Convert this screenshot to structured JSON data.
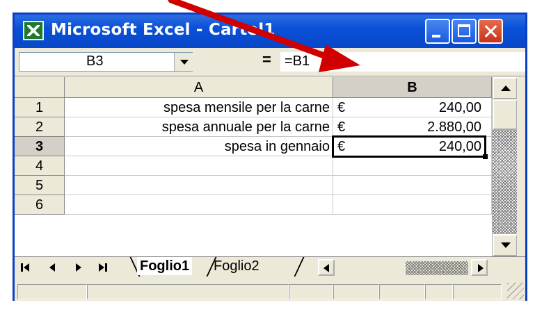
{
  "window": {
    "title": "Microsoft Excel - Cartel1"
  },
  "formula_bar": {
    "name_box": "B3",
    "equals": "=",
    "formula": "=B1"
  },
  "columns": [
    "A",
    "B"
  ],
  "rows": [
    {
      "num": "1",
      "label": "spesa mensile per la carne",
      "currency": "€",
      "amount": "240,00"
    },
    {
      "num": "2",
      "label": "spesa annuale per la carne",
      "currency": "€",
      "amount": "2.880,00"
    },
    {
      "num": "3",
      "label": "spesa in gennaio",
      "currency": "€",
      "amount": "240,00"
    },
    {
      "num": "4",
      "label": "",
      "currency": "",
      "amount": ""
    },
    {
      "num": "5",
      "label": "",
      "currency": "",
      "amount": ""
    },
    {
      "num": "6",
      "label": "",
      "currency": "",
      "amount": ""
    }
  ],
  "selected_cell": "B3",
  "sheet_tabs": [
    "Foglio1",
    "Foglio2"
  ],
  "active_tab": "Foglio1",
  "colors": {
    "titlebar": "#0a50d8",
    "annotation_arrow": "#d00000",
    "excel_icon": "#1f7a2e"
  }
}
